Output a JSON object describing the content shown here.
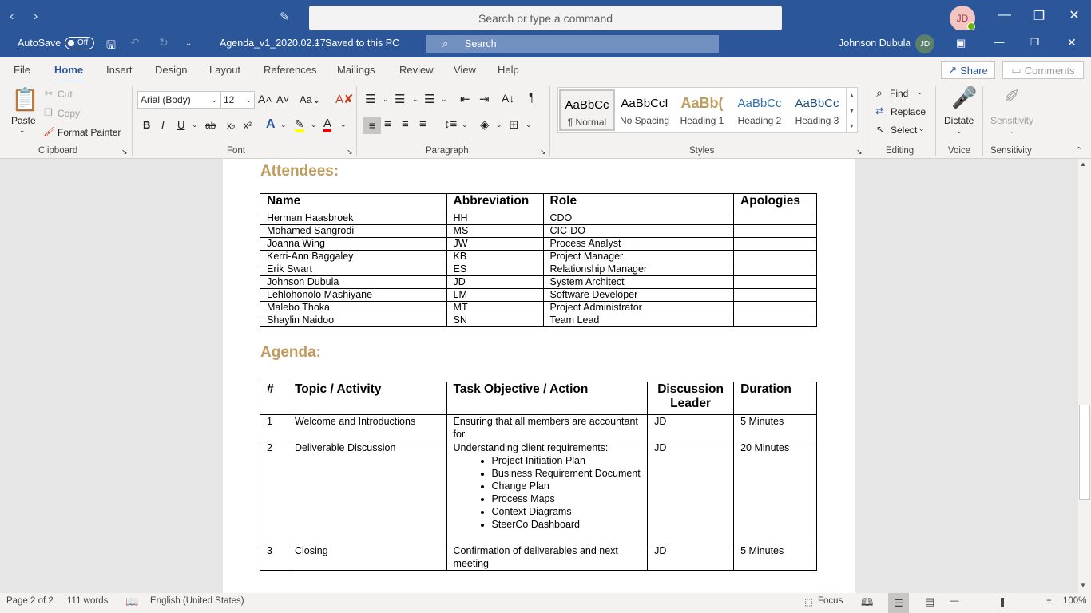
{
  "titlebar": {
    "command_placeholder": "Search or type a command",
    "avatar_initials": "JD"
  },
  "qat": {
    "autosave_label": "AutoSave",
    "autosave_state": "Off",
    "doc_title": "Agenda_v1_2020.02.17",
    "save_status": "Saved to this PC",
    "search_label": "Search",
    "user_name": "Johnson Dubula",
    "user_initials": "JD"
  },
  "menu": {
    "tabs": [
      "File",
      "Home",
      "Insert",
      "Design",
      "Layout",
      "References",
      "Mailings",
      "Review",
      "View",
      "Help"
    ],
    "active_tab": "Home",
    "share_label": "Share",
    "comments_label": "Comments"
  },
  "ribbon": {
    "clipboard": {
      "paste": "Paste",
      "cut": "Cut",
      "copy": "Copy",
      "format_painter": "Format Painter",
      "label": "Clipboard"
    },
    "font": {
      "family": "Arial (Body)",
      "size": "12",
      "label": "Font"
    },
    "paragraph": {
      "label": "Paragraph"
    },
    "styles": {
      "label": "Styles",
      "items": [
        {
          "preview": "AaBbCc",
          "name": "¶ Normal"
        },
        {
          "preview": "AaBbCcI",
          "name": "No Spacing"
        },
        {
          "preview": "AaBb(",
          "name": "Heading 1"
        },
        {
          "preview": "AaBbCc",
          "name": "Heading 2"
        },
        {
          "preview": "AaBbCc",
          "name": "Heading 3"
        }
      ]
    },
    "editing": {
      "find": "Find",
      "replace": "Replace",
      "select": "Select",
      "label": "Editing"
    },
    "voice": {
      "dictate": "Dictate",
      "label": "Voice"
    },
    "sensitivity": {
      "button": "Sensitivity",
      "label": "Sensitivity"
    }
  },
  "document": {
    "attendees_heading": "Attendees:",
    "attendees_headers": [
      "Name",
      "Abbreviation",
      "Role",
      "Apologies"
    ],
    "attendees": [
      [
        "Herman Haasbroek",
        "HH",
        "CDO",
        ""
      ],
      [
        "Mohamed Sangrodi",
        "MS",
        "CIC-DO",
        ""
      ],
      [
        "Joanna Wing",
        "JW",
        "Process Analyst",
        ""
      ],
      [
        "Kerri-Ann Baggaley",
        "KB",
        "Project Manager",
        ""
      ],
      [
        "Erik Swart",
        "ES",
        "Relationship Manager",
        ""
      ],
      [
        "Johnson Dubula",
        "JD",
        "System Architect",
        ""
      ],
      [
        "Lehlohonolo Mashiyane",
        "LM",
        "Software Developer",
        ""
      ],
      [
        "Malebo Thoka",
        "MT",
        "Project Administrator",
        ""
      ],
      [
        "Shaylin Naidoo",
        "SN",
        "Team Lead",
        ""
      ]
    ],
    "agenda_heading": "Agenda:",
    "agenda_headers": [
      "#",
      "Topic / Activity",
      "Task Objective / Action",
      "Discussion Leader",
      "Duration"
    ],
    "agenda": [
      {
        "num": "1",
        "topic": "Welcome and Introductions",
        "objective": "Ensuring that all members are accountant for",
        "bullets": [],
        "leader": "JD",
        "duration": "5 Minutes"
      },
      {
        "num": "2",
        "topic": "Deliverable Discussion",
        "objective": "Understanding client requirements:",
        "bullets": [
          "Project Initiation Plan",
          "Business Requirement Document",
          "Change Plan",
          "Process Maps",
          "Context Diagrams",
          "SteerCo Dashboard"
        ],
        "leader": "JD",
        "duration": "20 Minutes"
      },
      {
        "num": "3",
        "topic": "Closing",
        "objective": "Confirmation of deliverables and next meeting",
        "bullets": [],
        "leader": "JD",
        "duration": "5 Minutes"
      }
    ]
  },
  "status": {
    "page": "Page 2 of 2",
    "words": "111 words",
    "language": "English (United States)",
    "focus": "Focus",
    "zoom": "100%"
  },
  "colors": {
    "brand": "#2b579a",
    "heading": "#bf9b5d"
  }
}
